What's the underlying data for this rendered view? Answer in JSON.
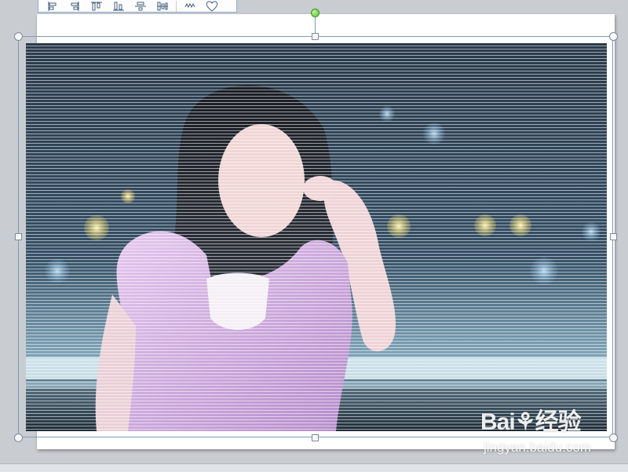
{
  "toolbar": {
    "buttons": [
      {
        "name": "align-left-icon"
      },
      {
        "name": "align-right-icon"
      },
      {
        "name": "align-top-icon"
      },
      {
        "name": "align-bottom-icon"
      },
      {
        "name": "align-center-icon"
      },
      {
        "name": "distribute-icon"
      },
      {
        "name": "more-icon"
      },
      {
        "name": "shape-icon"
      }
    ]
  },
  "picture": {
    "description_icon": "photo-of-woman-with-striped-effect"
  },
  "watermark": {
    "logo_text": "Bai⚘经验",
    "url_text": "jingyan.baidu.com"
  },
  "colors": {
    "selection": "#7f9cb8",
    "rotation_handle": "#57c22a",
    "canvas_bg": "#c9ccd1",
    "slide_bg": "#ffffff"
  }
}
